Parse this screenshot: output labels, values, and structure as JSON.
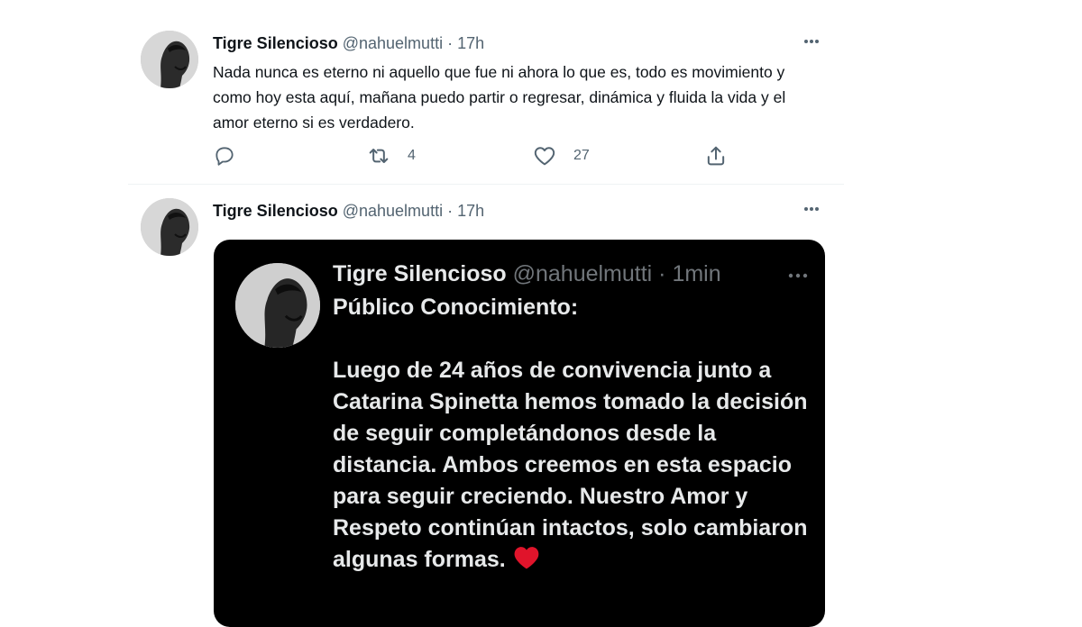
{
  "tweets": [
    {
      "author_name": "Tigre Silencioso",
      "handle": "@nahuelmutti",
      "separator": "·",
      "time": "17h",
      "text": "Nada nunca es eterno ni aquello que fue ni ahora lo que es, todo es movimiento y como hoy esta aquí, mañana puedo partir o regresar, dinámica y fluida la vida y el amor eterno si es verdadero.",
      "retweets": "4",
      "likes": "27"
    },
    {
      "author_name": "Tigre Silencioso",
      "handle": "@nahuelmutti",
      "separator": "·",
      "time": "17h",
      "embedded_screenshot": {
        "author_name": "Tigre Silencioso",
        "handle_time": "@nahuelmutti · 1min",
        "title": "Público Conocimiento:",
        "body": "Luego de 24 años de convivencia junto a Catarina Spinetta hemos tomado la decisión de seguir completándonos desde la distancia. Ambos creemos en esta espacio para seguir creciendo. Nuestro Amor y Respeto continúan intactos, solo cambiaron algunas formas.",
        "emoji": "red-heart"
      }
    }
  ],
  "colors": {
    "text_primary": "#0f1419",
    "text_secondary": "#536471",
    "divider": "#eff3f4",
    "dark_media_bg": "#000000",
    "heart_emoji": "#e0142b"
  }
}
